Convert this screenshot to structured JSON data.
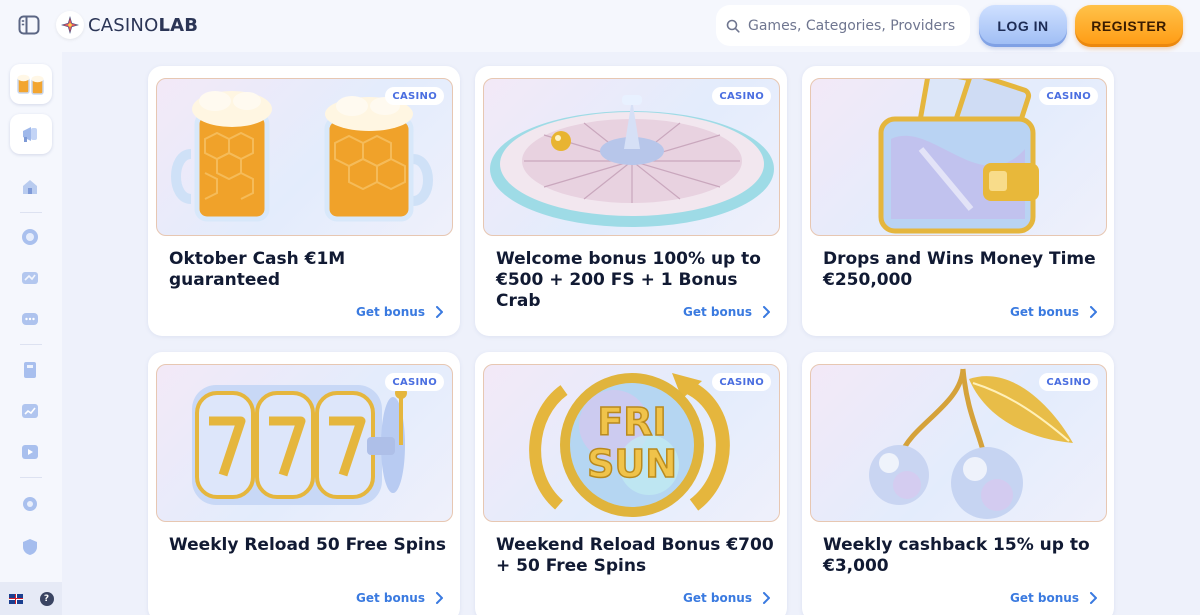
{
  "header": {
    "logo_prefix": "CASINO",
    "logo_suffix": "LAB",
    "search_placeholder": "Games, Categories, Providers",
    "login_label": "LOG IN",
    "register_label": "REGISTER"
  },
  "sidebar": {
    "items": [
      {
        "name": "oktoberfest-promo",
        "icon": "beer-mugs-icon"
      },
      {
        "name": "promotions",
        "icon": "megaphone-icon"
      },
      {
        "name": "home",
        "icon": "home-icon"
      },
      {
        "name": "casino",
        "icon": "chip-icon"
      },
      {
        "name": "slots",
        "icon": "slots-icon"
      },
      {
        "name": "live",
        "icon": "chat-icon"
      },
      {
        "name": "rules",
        "icon": "book-icon"
      },
      {
        "name": "tournaments",
        "icon": "chart-icon"
      },
      {
        "name": "video",
        "icon": "play-icon"
      },
      {
        "name": "settings",
        "icon": "gear-icon"
      },
      {
        "name": "security",
        "icon": "shield-icon"
      }
    ],
    "footer": {
      "language": "flag-uk-icon",
      "help": "?"
    }
  },
  "cards": [
    {
      "badge": "CASINO",
      "title": "Oktober Cash €1M guaranteed",
      "cta": "Get bonus",
      "image": "beer-mugs"
    },
    {
      "badge": "CASINO",
      "title": "Welcome bonus 100% up to €500 + 200 FS + 1 Bonus Crab",
      "cta": "Get bonus",
      "image": "roulette-wheel"
    },
    {
      "badge": "CASINO",
      "title": "Drops and Wins Money Time €250,000",
      "cta": "Get bonus",
      "image": "wallet"
    },
    {
      "badge": "CASINO",
      "title": "Weekly Reload 50 Free Spins",
      "cta": "Get bonus",
      "image": "slot-reels-777"
    },
    {
      "badge": "CASINO",
      "title": "Weekend Reload Bonus €700 + 50 Free Spins",
      "cta": "Get bonus",
      "image": "fri-sun-coin",
      "image_text_1": "FRI",
      "image_text_2": "SUN"
    },
    {
      "badge": "CASINO",
      "title": "Weekly cashback 15% up to €3,000",
      "cta": "Get bonus",
      "image": "cherries"
    }
  ],
  "colors": {
    "accent_blue": "#3a7ae0",
    "register_orange": "#ff9a12",
    "login_blue": "#9dbcf4",
    "background": "#eef1fb"
  }
}
